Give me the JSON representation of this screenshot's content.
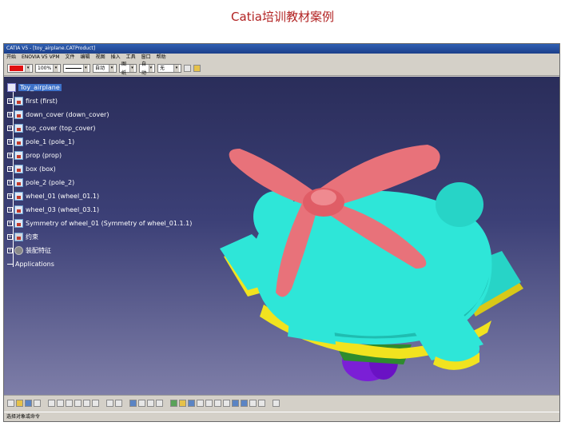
{
  "caption": "Catia培训教材案例",
  "window": {
    "title": "CATIA V5 - [toy_airplane.CATProduct]"
  },
  "menu": [
    "开始",
    "ENOVIA V5 VPM",
    "文件",
    "编辑",
    "视图",
    "插入",
    "工具",
    "窗口",
    "帮助"
  ],
  "toolbar": {
    "color_hex": "#e01010",
    "zoom": "100%",
    "linetype": "",
    "thickness": "自动",
    "layer": "图纸",
    "style": "自动",
    "layer_name": "无"
  },
  "tree": {
    "root": "Toy_airplane",
    "items": [
      {
        "label": "first (first)",
        "icon": "part-icon"
      },
      {
        "label": "down_cover (down_cover)",
        "icon": "part-icon"
      },
      {
        "label": "top_cover (top_cover)",
        "icon": "part-icon"
      },
      {
        "label": "pole_1 (pole_1)",
        "icon": "part-icon"
      },
      {
        "label": "prop (prop)",
        "icon": "part-icon"
      },
      {
        "label": "box (box)",
        "icon": "part-icon"
      },
      {
        "label": "pole_2 (pole_2)",
        "icon": "part-icon"
      },
      {
        "label": "wheel_01 (wheel_01.1)",
        "icon": "part-icon"
      },
      {
        "label": "wheel_03 (wheel_03.1)",
        "icon": "part-icon"
      },
      {
        "label": "Symmetry of wheel_01 (Symmetry of wheel_01.1.1)",
        "icon": "part-icon"
      },
      {
        "label": "约束",
        "icon": "constraint-icon"
      },
      {
        "label": "装配特征",
        "icon": "assembly-feature-icon"
      },
      {
        "label": "Applications",
        "icon": ""
      }
    ]
  },
  "colors": {
    "body": "#2ee6d8",
    "propeller": "#e8727a",
    "wheel": "#7b1fd6",
    "trim": "#f1e31f",
    "background_top": "#2a2d5a",
    "background_bottom": "#7e7ea8"
  },
  "status": "选择对象或命令"
}
